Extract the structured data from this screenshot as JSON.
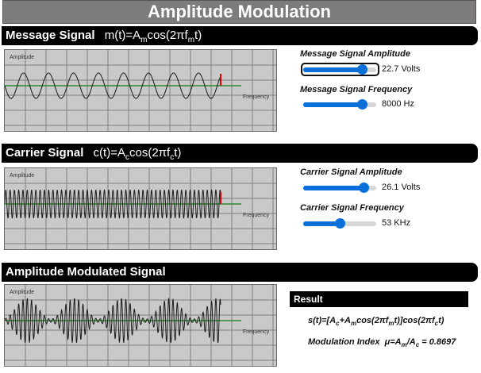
{
  "title": "Amplitude Modulation",
  "message": {
    "heading": "Message Signal",
    "formula_parts": [
      "m(t)=A",
      "m",
      "cos(2πf",
      "m",
      "t)"
    ],
    "plot_ylabel": "Amplitude",
    "plot_xlabel": "Frequency",
    "amplitude_label": "Message Signal Amplitude",
    "amplitude_value": "22.7 Volts",
    "amplitude_level": 0.8,
    "frequency_label": "Message Signal Frequency",
    "frequency_value": "8000 Hz",
    "frequency_level": 0.8
  },
  "carrier": {
    "heading": "Carrier Signal",
    "formula_parts": [
      "c(t)=A",
      "c",
      "cos(2πf",
      "c",
      "t)"
    ],
    "plot_ylabel": "Amplitude",
    "plot_xlabel": "Frequency",
    "amplitude_label": "Carrier Signal Amplitude",
    "amplitude_value": "26.1 Volts",
    "amplitude_level": 0.83,
    "frequency_label": "Carrier Signal Frequency",
    "frequency_value": "53 KHz",
    "frequency_level": 0.5
  },
  "modulated": {
    "heading": "Amplitude Modulated Signal",
    "plot_ylabel": "Amplitude",
    "plot_xlabel": "Frequency"
  },
  "result": {
    "heading": "Result",
    "equation_parts": [
      "s(t)=[A",
      "c",
      "+A",
      "m",
      "cos(2πf",
      "m",
      "t)]cos(2πf",
      "c",
      "t)"
    ],
    "index_label": "Modulation Index",
    "index_parts": [
      "μ=A",
      "m",
      "/A",
      "c",
      " = 0.8697"
    ]
  },
  "colors": {
    "plot_bg": "#c9c9c9",
    "grid": "#7f7f7f",
    "axis": "#2e8b2e",
    "wave": "#1a1a1a",
    "marker": "#e00000",
    "accent": "#0a6fd8"
  }
}
